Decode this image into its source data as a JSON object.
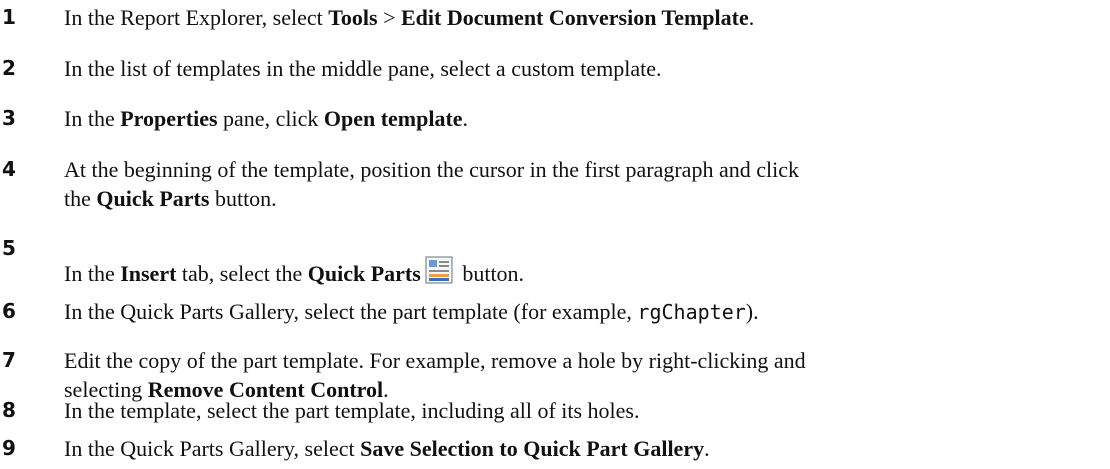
{
  "steps": [
    {
      "number": "1",
      "parts": [
        "In the Report Explorer, select ",
        "Tools",
        " > ",
        "Edit Document Conversion Template",
        "."
      ]
    },
    {
      "number": "2",
      "parts": [
        "In the list of templates in the middle pane, select a custom template."
      ]
    },
    {
      "number": "3",
      "parts": [
        "In the ",
        "Properties",
        " pane, click ",
        "Open template",
        "."
      ]
    },
    {
      "number": "4",
      "parts": [
        "At the beginning of the template, position the cursor in the first paragraph and click",
        "the ",
        "Quick Parts",
        " button."
      ]
    },
    {
      "number": "5",
      "parts": [
        "In the ",
        "Insert",
        " tab, select the ",
        "Quick Parts",
        " button."
      ],
      "icon": "quick-parts-icon"
    },
    {
      "number": "6",
      "parts": [
        "In the Quick Parts Gallery, select the part template (for example, ",
        "rgChapter",
        ")."
      ]
    },
    {
      "number": "7",
      "parts": [
        "Edit the copy of the part template. For example, remove a hole by right-clicking and",
        "selecting ",
        "Remove Content Control",
        "."
      ]
    },
    {
      "number": "8",
      "parts": [
        "In the template, select the part template, including all of its holes."
      ]
    },
    {
      "number": "9",
      "parts": [
        "In the Quick Parts Gallery, select ",
        "Save Selection to Quick Part Gallery",
        "."
      ]
    }
  ]
}
